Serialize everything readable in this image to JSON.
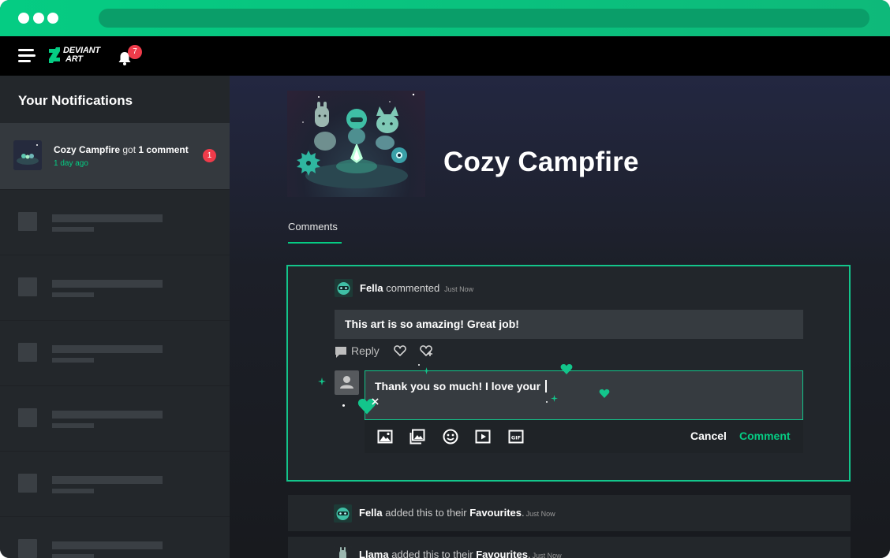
{
  "app": {
    "name": "DeviantArt",
    "logo_line1": "DEVIANT",
    "logo_line2": "ART"
  },
  "colors": {
    "accent": "#05cc83",
    "badge": "#ef3b4a",
    "sidebar": "#23272b",
    "card_border": "#13c58b"
  },
  "topbar": {
    "notification_count": "7"
  },
  "sidebar": {
    "title": "Your Notifications",
    "active_item": {
      "subject": "Cozy Campfire",
      "verb": "got",
      "object": "1 comment",
      "time": "1 day ago",
      "count": "1"
    },
    "placeholder_rows": 6
  },
  "artwork": {
    "title": "Cozy Campfire"
  },
  "tabs": [
    {
      "label": "Comments",
      "active": true
    }
  ],
  "comment": {
    "author": "Fella",
    "action": "commented",
    "time": "Just Now",
    "body": "This art is so amazing! Great job!",
    "reply_label": "Reply"
  },
  "reply_box": {
    "text": "Thank you so much! I love your",
    "tools": [
      "image-icon",
      "gallery-icon",
      "emoji-icon",
      "video-icon",
      "gif-icon"
    ],
    "cancel_label": "Cancel",
    "submit_label": "Comment"
  },
  "activity": [
    {
      "user": "Fella",
      "action": "added this to their",
      "target": "Favourites",
      "time": "Just Now"
    },
    {
      "user": "Llama",
      "action": "added this to their",
      "target": "Favourites",
      "time": "Just Now"
    }
  ]
}
